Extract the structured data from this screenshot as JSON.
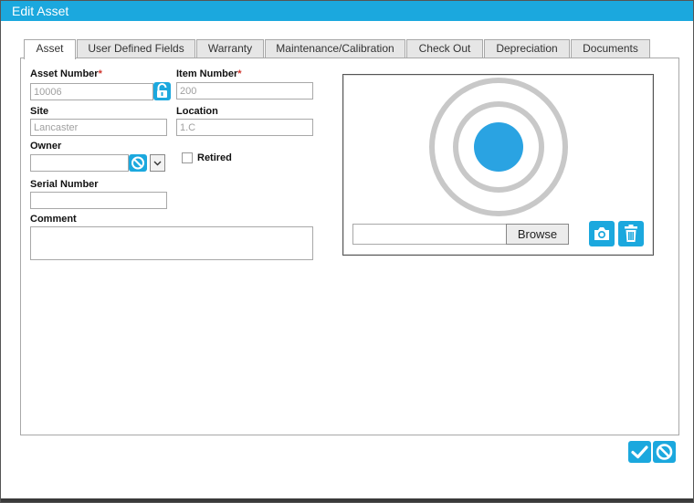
{
  "window": {
    "title": "Edit Asset"
  },
  "tabs": [
    {
      "label": "Asset",
      "active": true
    },
    {
      "label": "User Defined Fields",
      "active": false
    },
    {
      "label": "Warranty",
      "active": false
    },
    {
      "label": "Maintenance/Calibration",
      "active": false
    },
    {
      "label": "Check Out",
      "active": false
    },
    {
      "label": "Depreciation",
      "active": false
    },
    {
      "label": "Documents",
      "active": false
    }
  ],
  "form": {
    "asset_number": {
      "label": "Asset Number",
      "required_mark": "*",
      "value": "10006"
    },
    "item_number": {
      "label": "Item Number",
      "required_mark": "*",
      "value": "200"
    },
    "site": {
      "label": "Site",
      "value": "Lancaster"
    },
    "location": {
      "label": "Location",
      "value": "1.C"
    },
    "owner": {
      "label": "Owner",
      "value": ""
    },
    "retired": {
      "label": "Retired",
      "checked": false
    },
    "serial_number": {
      "label": "Serial Number",
      "value": ""
    },
    "comment": {
      "label": "Comment",
      "value": ""
    }
  },
  "image": {
    "browse_label": "Browse",
    "file_value": ""
  },
  "icons": {
    "lock": "lock-open-icon",
    "clear": "clear-icon",
    "dropdown": "chevron-down-icon",
    "placeholder": "target-placeholder-icon",
    "camera": "camera-icon",
    "trash": "trash-icon",
    "save": "check-icon",
    "cancel": "cancel-icon"
  },
  "colors": {
    "accent": "#1ba8de",
    "required": "#d0342c",
    "placeholder_ring": "#c8c8c8",
    "placeholder_dot": "#2aa3e2"
  }
}
